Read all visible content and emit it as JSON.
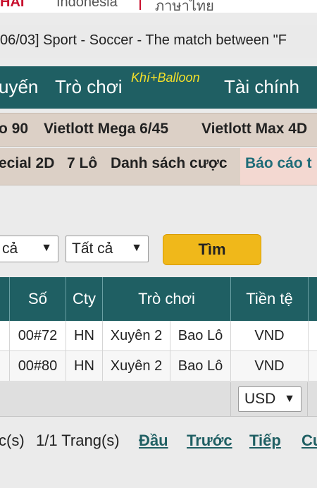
{
  "header": {
    "logo_fragment": "HAI",
    "languages": [
      "Indonesia",
      "ภาษาไทย"
    ]
  },
  "ticker": {
    "text": "06/03] Sport - Soccer - The match between \"F"
  },
  "nav": {
    "items": [
      "uyến",
      "Trò chơi",
      "Tài chính"
    ],
    "tag": "Khí+Balloon"
  },
  "lottery_menu": {
    "items": [
      "o 90",
      "Vietlott Mega 6/45",
      "Vietlott Max 4D"
    ]
  },
  "sub_menu": {
    "items": [
      "ecial 2D",
      "7 Lô",
      "Danh sách cược",
      "Báo cáo t"
    ]
  },
  "filters": {
    "select1_value": "cả",
    "select2_value": "Tất cả",
    "search_label": "Tìm"
  },
  "table": {
    "headers": [
      "Số",
      "Cty",
      "Trò chơi",
      "Tiền tệ"
    ],
    "rows": [
      {
        "so": "00#72",
        "cty": "HN",
        "game1": "Xuyên 2",
        "game2": "Bao Lô",
        "currency": "VND"
      },
      {
        "so": "00#80",
        "cty": "HN",
        "game1": "Xuyên 2",
        "game2": "Bao Lô",
        "currency": "VND"
      }
    ],
    "currency_select": "USD"
  },
  "pager": {
    "records": "c(s)",
    "pages": "1/1 Trang(s)",
    "first": "Đầu",
    "prev": "Trước",
    "next": "Tiếp",
    "last": "Cu"
  },
  "colors": {
    "nav_bg": "#1f5f63",
    "accent_yellow": "#f0b81a",
    "menu_bg": "#dcd0c6"
  }
}
